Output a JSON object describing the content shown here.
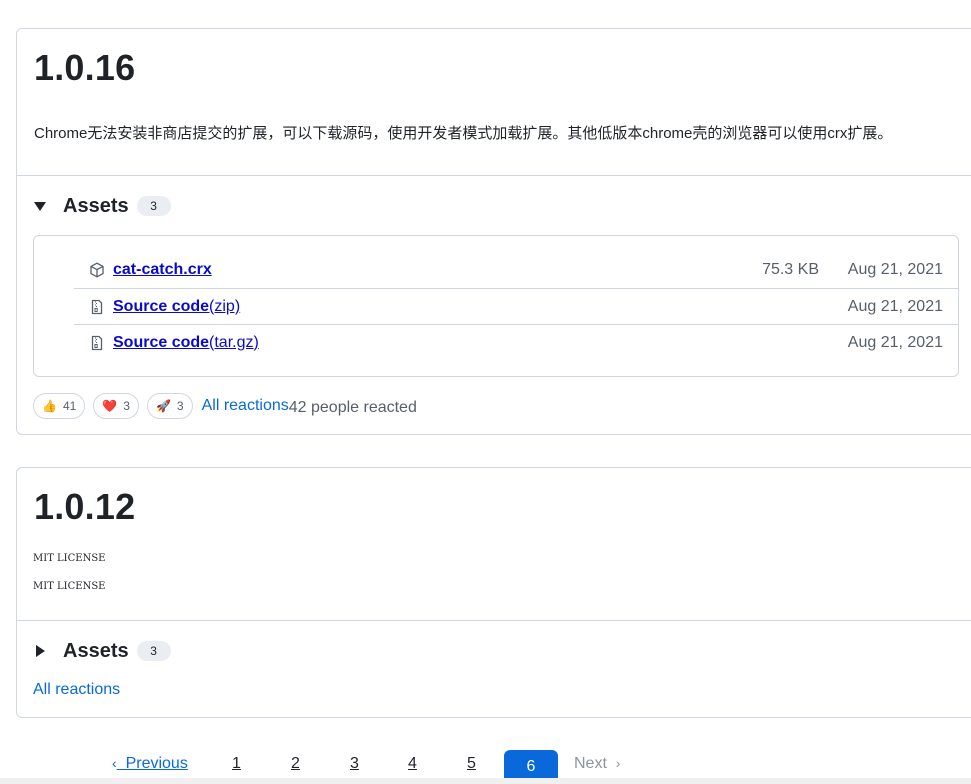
{
  "releases": [
    {
      "version": "1.0.16",
      "description": "Chrome无法安装非商店提交的扩展，可以下载源码，使用开发者模式加载扩展。其他低版本chrome壳的浏览器可以使用crx扩展。",
      "assets_label": "Assets",
      "assets_count": "3",
      "assets": [
        {
          "name": "cat-catch.crx",
          "suffix": "",
          "size": "75.3 KB",
          "date": "Aug 21, 2021",
          "icon": "package-icon"
        },
        {
          "name": "Source code",
          "suffix": "(zip)",
          "size": "",
          "date": "Aug 21, 2021",
          "icon": "file-zip-icon"
        },
        {
          "name": "Source code",
          "suffix": "(tar.gz)",
          "size": "",
          "date": "Aug 21, 2021",
          "icon": "file-zip-icon"
        }
      ],
      "reactions": [
        {
          "emoji": "👍",
          "count": "41",
          "name": "thumbs-up"
        },
        {
          "emoji": "❤️",
          "count": "3",
          "name": "heart"
        },
        {
          "emoji": "🚀",
          "count": "3",
          "name": "rocket"
        }
      ],
      "all_reactions": "All reactions",
      "people_reacted": "42 people reacted"
    },
    {
      "version": "1.0.12",
      "lines": [
        "MIT LICENSE",
        "MIT LICENSE"
      ],
      "assets_label": "Assets",
      "assets_count": "3",
      "all_reactions": "All reactions"
    }
  ],
  "pagination": {
    "previous": "Previous",
    "pages": [
      "1",
      "2",
      "3",
      "4",
      "5"
    ],
    "current": "6",
    "next": "Next"
  },
  "colors": {
    "link": "#0969da",
    "current_page_bg": "#0969da",
    "border": "#d0d7de"
  }
}
